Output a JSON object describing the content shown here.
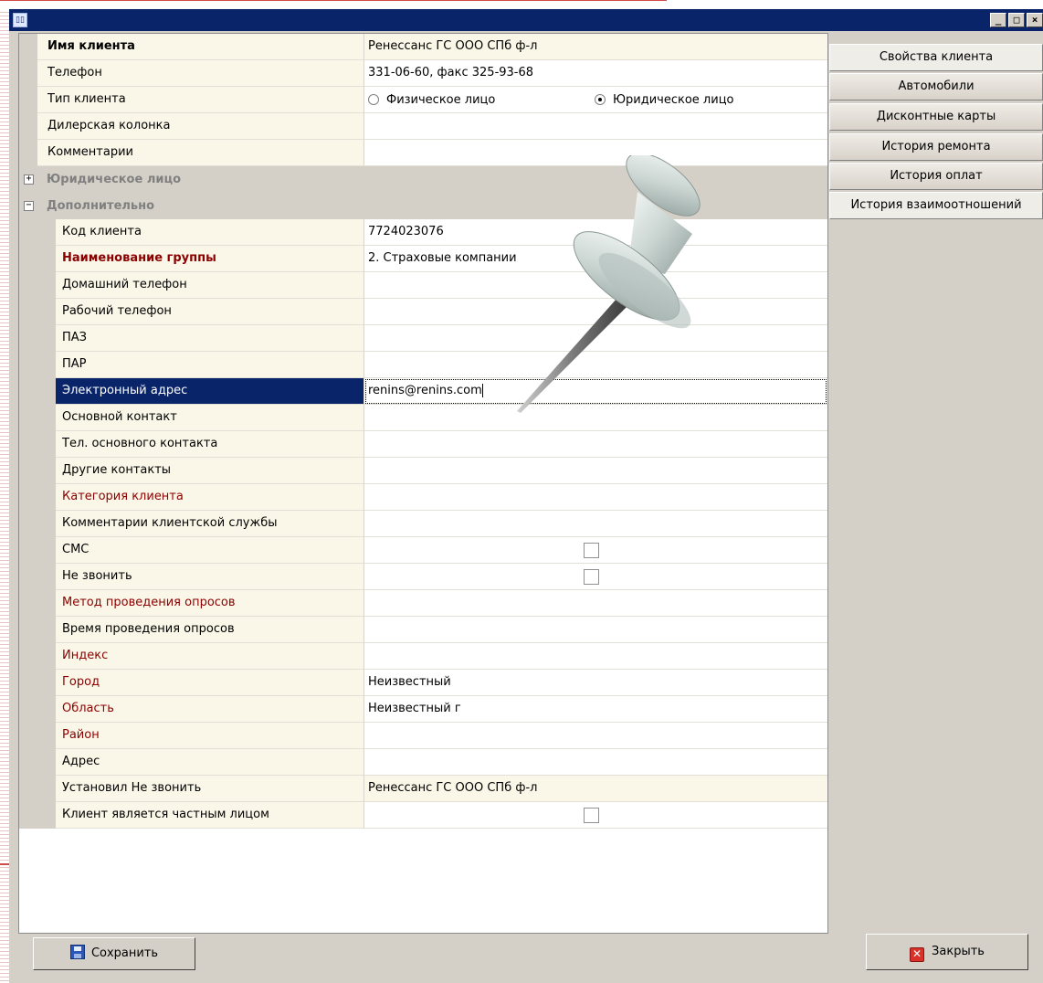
{
  "window": {
    "title": "",
    "title_icon": "book-icon",
    "controls": [
      "_",
      "□",
      "×"
    ]
  },
  "grid": {
    "top_rows": [
      {
        "label": "Имя клиента",
        "value": "Ренессанс ГС ООО СПб ф-л"
      },
      {
        "label": "Телефон",
        "value": "331-06-60, факс 325-93-68"
      },
      {
        "label": "Тип клиента",
        "radio_options": [
          "Физическое лицо",
          "Юридическое лицо"
        ],
        "selected": "Юридическое лицо"
      },
      {
        "label": "Дилерская колонка",
        "value": ""
      },
      {
        "label": "Комментарии",
        "value": ""
      }
    ],
    "categories": [
      {
        "label": "Юридическое лицо",
        "expander": "+"
      },
      {
        "label": "Дополнительно",
        "expander": "−"
      }
    ],
    "sub_rows": [
      {
        "label": "Код клиента",
        "value": "7724023076"
      },
      {
        "label": "Наименование группы",
        "value": "2. Страховые компании"
      },
      {
        "label": "Домашний телефон",
        "value": ""
      },
      {
        "label": "Рабочий телефон",
        "value": ""
      },
      {
        "label": "ПАЗ",
        "value": ""
      },
      {
        "label": "ПАР",
        "value": ""
      },
      {
        "label": "Электронный адрес",
        "value": "renins@renins.com"
      },
      {
        "label": "Основной контакт",
        "value": ""
      },
      {
        "label": "Тел. основного контакта",
        "value": ""
      },
      {
        "label": "Другие контакты",
        "value": ""
      },
      {
        "label": "Категория клиента",
        "value": ""
      },
      {
        "label": "Комментарии клиентской службы",
        "value": ""
      },
      {
        "label": "СМС",
        "checked": false
      },
      {
        "label": "Не звонить",
        "checked": false
      },
      {
        "label": "Метод проведения опросов",
        "value": ""
      },
      {
        "label": "Время проведения опросов",
        "value": ""
      },
      {
        "label": "Индекс",
        "value": ""
      },
      {
        "label": "Город",
        "value": "Неизвестный"
      },
      {
        "label": "Область",
        "value": "Неизвестный г"
      },
      {
        "label": "Район",
        "value": ""
      },
      {
        "label": "Адрес",
        "value": ""
      },
      {
        "label": "Установил Не звонить",
        "value": "Ренессанс ГС ООО СПб ф-л"
      },
      {
        "label": "Клиент является частным лицом",
        "checked": false
      }
    ]
  },
  "tabs": [
    "Свойства клиента",
    "Автомобили",
    "Дисконтные карты",
    "История ремонта",
    "История оплат",
    "История взаимоотношений"
  ],
  "buttons": {
    "save": "Сохранить",
    "close": "Закрыть"
  },
  "colors": {
    "titlebar": "#0a246a",
    "selection": "#0a246a",
    "required_label": "#8b0000",
    "name_column": "#fbf7e8"
  },
  "overlay": {
    "icon": "pushpin-icon"
  }
}
